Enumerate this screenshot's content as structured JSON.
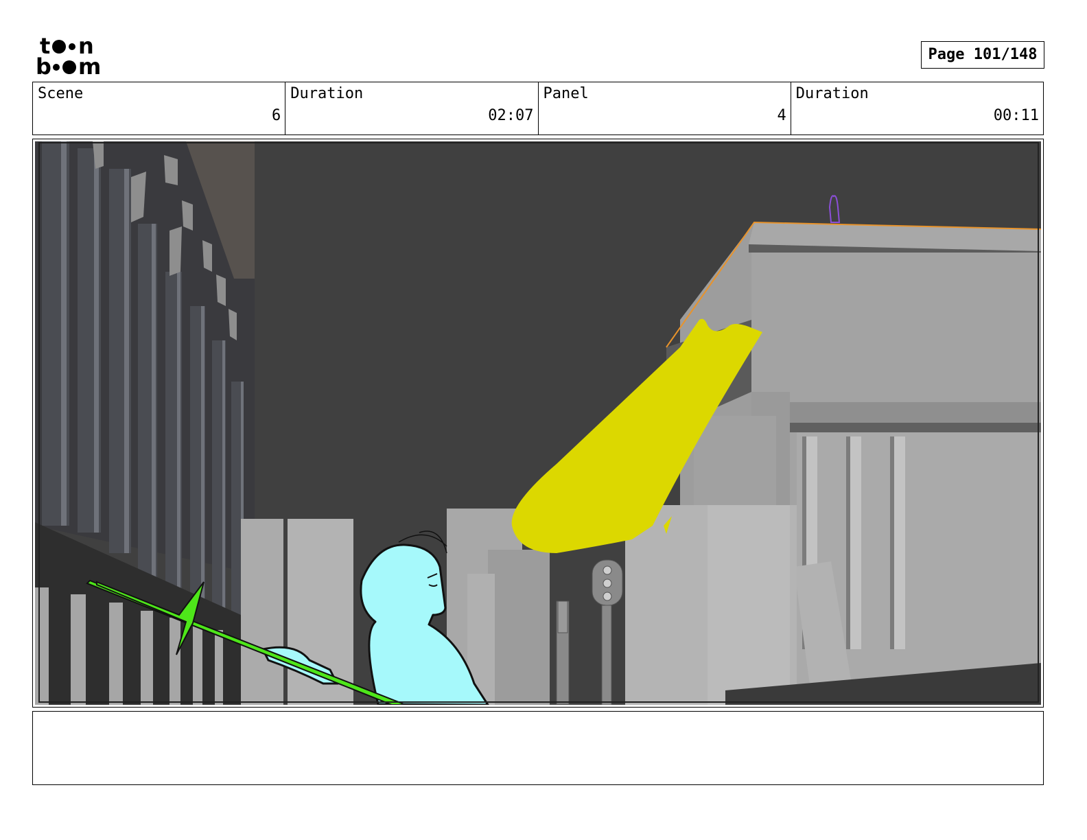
{
  "logo": {
    "line1": "toon",
    "line2": "boom",
    "icon": "toon-boom-logo"
  },
  "page": {
    "label": "Page 101/148"
  },
  "info": {
    "scene_label": "Scene",
    "scene_value": "6",
    "scene_duration_label": "Duration",
    "scene_duration_value": "02:07",
    "panel_label": "Panel",
    "panel_value": "4",
    "panel_duration_label": "Duration",
    "panel_duration_value": "00:11"
  },
  "panel_image": {
    "colors": {
      "sky": "#404040",
      "buildings_light": "#a9a9a9",
      "buildings_mid": "#8c8c8c",
      "beam": "#dcd800",
      "character": "#a6f9fb",
      "spear": "#4ee61a",
      "outline_orange": "#e8932b",
      "figure_purple": "#8b4fd8"
    }
  },
  "notes": {
    "text": ""
  }
}
